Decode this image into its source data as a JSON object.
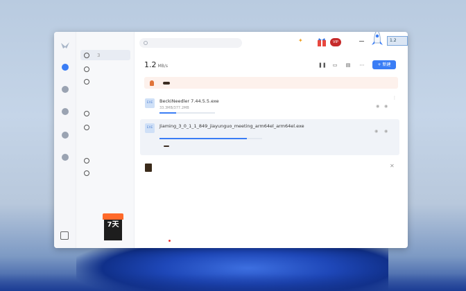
{
  "app": {
    "title": "1.2",
    "title_unit": "MB/s",
    "size_tag": "1.2",
    "vip_label": "VIP",
    "badge_7": "7天"
  },
  "search": {
    "placeholder": ""
  },
  "rail": {
    "items": [
      {
        "label": ""
      },
      {
        "label": ""
      },
      {
        "label": ""
      },
      {
        "label": ""
      },
      {
        "label": ""
      }
    ]
  },
  "panel": {
    "heading_1": "",
    "heading_2": "",
    "heading_3": "",
    "items": [
      {
        "label": "",
        "count": "3"
      },
      {
        "label": ""
      },
      {
        "label": ""
      },
      {
        "label": ""
      },
      {
        "label": ""
      },
      {
        "label": ""
      },
      {
        "label": ""
      }
    ]
  },
  "promo": {
    "top": "",
    "days": "7天",
    "sub": ""
  },
  "toolbar": {
    "new_label": "+ 新建"
  },
  "banner": {
    "text": "",
    "button": ""
  },
  "tasks": [
    {
      "icon": "EXE",
      "name": "BeckiNeedler 7.44.5.5.exe",
      "meta": "33.3MB/377.2MB",
      "status": "",
      "rate": "",
      "progress": 0.3
    },
    {
      "icon": "EXE",
      "name": "Jiaming_3_0_1_1_849_jiayunguo_meeting_arm64el_arm64el.exe",
      "meta": "",
      "status": "",
      "rate": "",
      "progress": 0.85,
      "boost_text": "",
      "boost_button": ""
    }
  ],
  "group": {
    "name": "",
    "tag": "",
    "meta": ""
  },
  "footer": {
    "items": [
      "",
      "",
      "",
      "",
      ""
    ]
  },
  "colors": {
    "accent": "#3a7df5",
    "promo_orange": "#ff6a2a",
    "banner_bg": "#fdf1ec"
  }
}
